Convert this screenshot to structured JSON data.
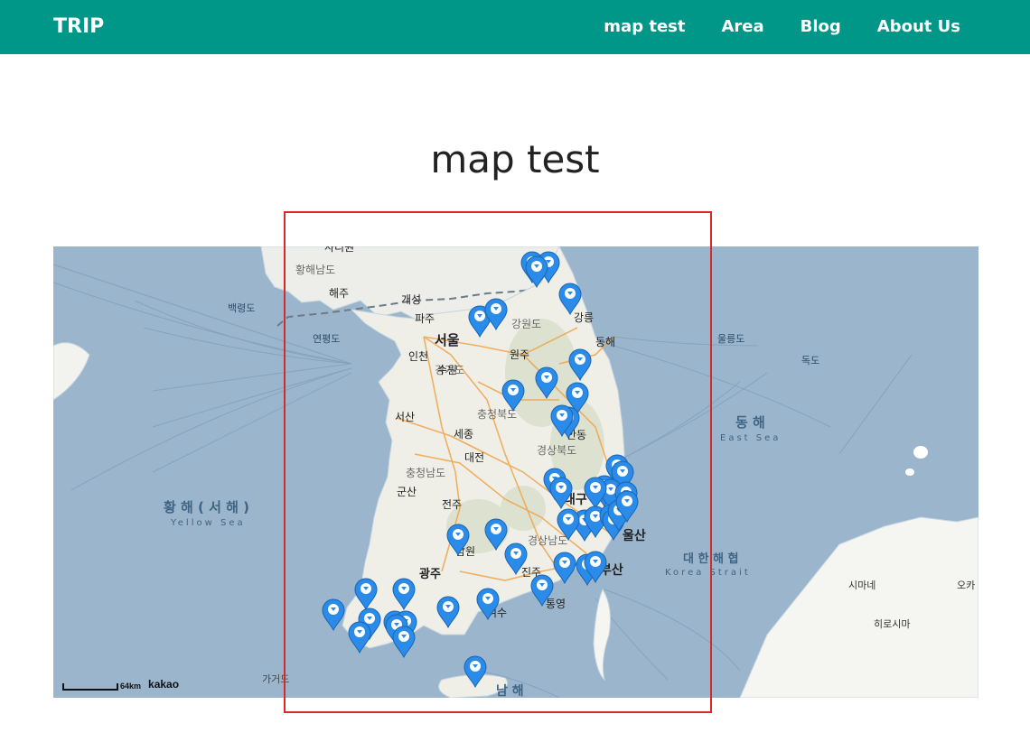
{
  "navbar": {
    "brand": "TRIP",
    "links": [
      "map test",
      "Area",
      "Blog",
      "About Us"
    ],
    "color": "#009688"
  },
  "page": {
    "title": "map test"
  },
  "map": {
    "provider": "kakao",
    "scale_label": "64km",
    "water_color": "#9bb6cc",
    "land_color": "#efefe8",
    "marker_color": "#2b8be8",
    "highlight_color": "#d62a2a",
    "labels": {
      "seoul": "서울",
      "incheon": "인천",
      "sejong": "세종",
      "daejeon": "대전",
      "daegu": "대구",
      "gwangju": "광주",
      "busan": "부산",
      "ulsan": "울산",
      "gangneung": "강릉",
      "wonju": "원주",
      "andong": "안동",
      "jeonju": "전주",
      "jinju": "진주",
      "tongyeong": "통영",
      "yeosu": "여수",
      "namwon": "남원",
      "suwon": "수원",
      "kaesong": "개성",
      "paju": "파주",
      "haeju": "해주",
      "donghae": "동해",
      "seosan": "서산",
      "gunsan": "군산",
      "gyeonggido": "경기도",
      "gangwondo": "강원도",
      "chungcheongbukdo": "충청북도",
      "chungcheongnamdo": "충청남도",
      "gyeongsangbukdo": "경상북도",
      "gyeongsangnamdo": "경상남도",
      "hwanghaenamdo": "황해남도",
      "yellow_sea_ko": "황 해 ( 서 해 )",
      "yellow_sea_en": "Yellow Sea",
      "east_sea_ko": "동 해",
      "east_sea_en": "East Sea",
      "korea_strait_ko": "대 한 해 협",
      "korea_strait_en": "Korea Strait",
      "south_sea_ko": "남 해",
      "ulleungdo": "울릉도",
      "dokdo": "독도",
      "baengnyeongdo": "백령도",
      "yeonpyeongdo": "연평도",
      "gageodo": "가거도",
      "shimane": "시마네",
      "hiroshima": "히로시마",
      "okayama": "오카"
    }
  }
}
